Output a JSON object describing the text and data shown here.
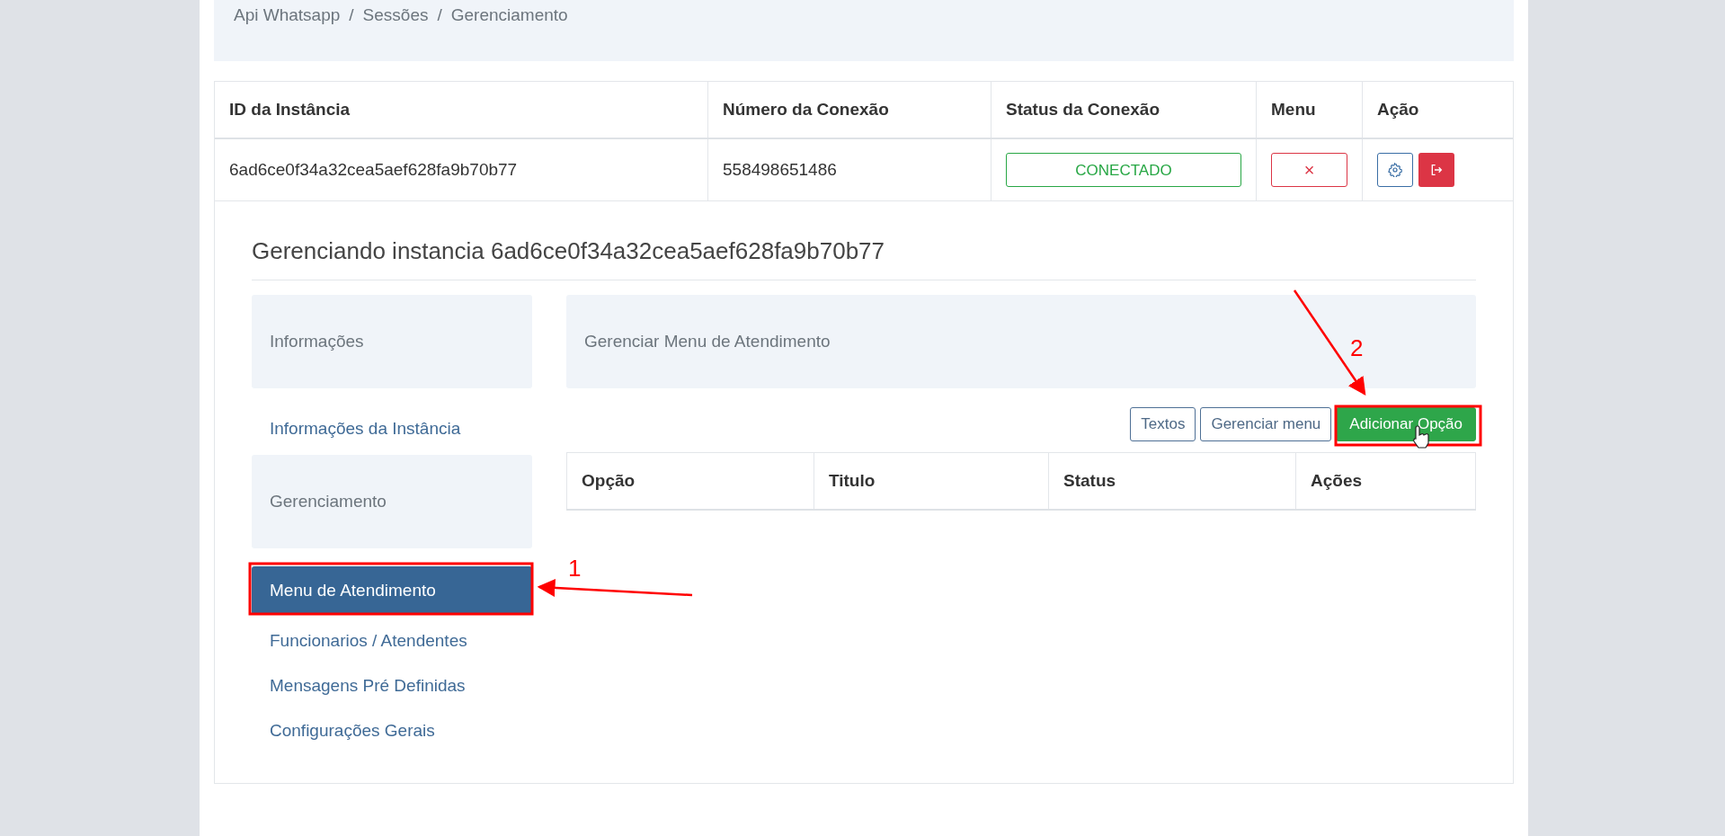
{
  "breadcrumb": {
    "items": [
      "Api Whatsapp",
      "Sessões",
      "Gerenciamento"
    ],
    "separator": "/"
  },
  "instances": {
    "columns": [
      "ID da Instância",
      "Número da Conexão",
      "Status da Conexão",
      "Menu",
      "Ação"
    ],
    "rows": [
      {
        "id": "6ad6ce0f34a32cea5aef628fa9b70b77",
        "number": "558498651486",
        "status": "CONECTADO",
        "menu": "×"
      }
    ]
  },
  "manage": {
    "title": "Gerenciando instancia 6ad6ce0f34a32cea5aef628fa9b70b77",
    "sidebar": [
      {
        "kind": "section",
        "label": "Informações"
      },
      {
        "kind": "link",
        "label": "Informações da Instância",
        "selected": false
      },
      {
        "kind": "section",
        "label": "Gerenciamento"
      },
      {
        "kind": "link",
        "label": "Menu de Atendimento",
        "selected": true
      },
      {
        "kind": "link",
        "label": "Funcionarios / Atendentes",
        "selected": false
      },
      {
        "kind": "link",
        "label": "Mensagens Pré Definidas",
        "selected": false
      },
      {
        "kind": "link",
        "label": "Configurações Gerais",
        "selected": false
      }
    ],
    "panel_title": "Gerenciar Menu de Atendimento",
    "buttons": [
      {
        "label": "Textos",
        "kind": "outline"
      },
      {
        "label": "Gerenciar menu",
        "kind": "outline"
      },
      {
        "label": "Adicionar Opção",
        "kind": "primary"
      }
    ],
    "options_table": {
      "columns": [
        "Opção",
        "Titulo",
        "Status",
        "Ações"
      ]
    }
  },
  "annotations": [
    {
      "label": "1"
    },
    {
      "label": "2"
    }
  ]
}
